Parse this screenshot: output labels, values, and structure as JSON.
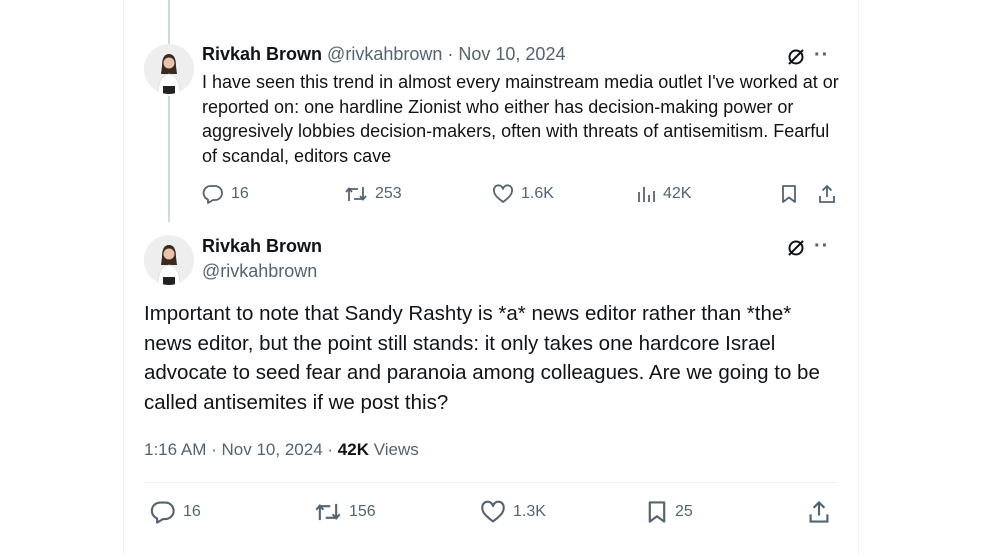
{
  "tweet1": {
    "author_name": "Rivkah Brown",
    "author_handle": "@rivkahbrown",
    "separator": "·",
    "date": "Nov 10, 2024",
    "text": "I have seen this trend in almost every mainstream media outlet I've worked at or reported on: one hardline Zionist who either has decision-making power or aggresively lobbies decision-makers, often with threats of antisemitism. Fearful of scandal, editors cave",
    "replies": "16",
    "reposts": "253",
    "likes": "1.6K",
    "views": "42K",
    "icons": [
      "grok-icon",
      "more-icon",
      "reply-icon",
      "repost-icon",
      "like-icon",
      "views-icon",
      "bookmark-icon",
      "share-icon"
    ]
  },
  "tweet2": {
    "author_name": "Rivkah Brown",
    "author_handle": "@rivkahbrown",
    "text": "Important to note that Sandy Rashty is *a* news editor rather than *the* news editor, but the point still stands: it only takes one hardcore Israel advocate to seed fear and paranoia among colleagues. Are we going to be called antisemites if we post this?",
    "time": "1:16 AM",
    "separator": "·",
    "date": "Nov 10, 2024",
    "separator2": "·",
    "views_count": "42K",
    "views_label": "Views",
    "replies": "16",
    "reposts": "156",
    "likes": "1.3K",
    "bookmarks": "25"
  },
  "colors": {
    "text": "#0f1419",
    "muted": "#536471",
    "border": "#eff3f4",
    "thread": "#cfd9de"
  }
}
